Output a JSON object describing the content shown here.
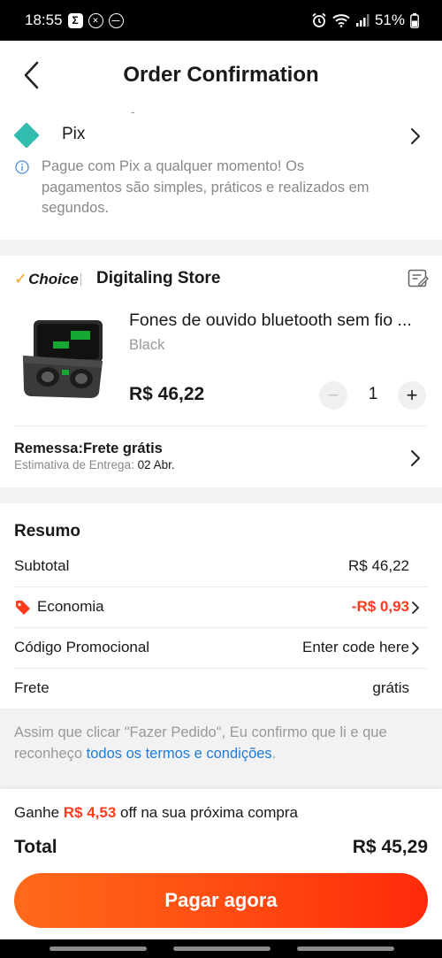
{
  "status_bar": {
    "time": "18:55",
    "battery": "51%",
    "icons": [
      "sigma-icon",
      "x-circle-icon",
      "minus-circle-icon",
      "alarm-icon",
      "wifi-icon",
      "signal-icon",
      "battery-icon"
    ]
  },
  "header": {
    "title": "Order Confirmation",
    "back_icon": "chevron-left-icon"
  },
  "payment": {
    "dash": "-",
    "method": "Pix",
    "note": "Pague com Pix a qualquer momento! Os pagamentos são simples, práticos e realizados em segundos.",
    "icon": "pix-icon"
  },
  "store": {
    "badge": "Choice",
    "name": "Digitaling Store",
    "note_icon": "edit-note-icon"
  },
  "product": {
    "title": "Fones de ouvido bluetooth sem fio ...",
    "variant": "Black",
    "price": "R$ 46,22",
    "quantity": "1",
    "minus": "−",
    "plus": "+"
  },
  "shipping": {
    "title": "Remessa:Frete grátis",
    "estimate_label": "Estimativa de Entrega:",
    "estimate_date": "02 Abr."
  },
  "summary": {
    "title": "Resumo",
    "subtotal_label": "Subtotal",
    "subtotal_value": "R$ 46,22",
    "savings_label": "Economia",
    "savings_value": "-R$ 0,93",
    "promo_label": "Código Promocional",
    "promo_value": "Enter code here",
    "shipping_label": "Frete",
    "shipping_value": "grátis"
  },
  "terms": {
    "text": "Assim que clicar \"Fazer Pedido\", Eu confirmo que li e que reconheço ",
    "link": "todos os termos e condições",
    "end": "."
  },
  "footer": {
    "earn_prefix": "Ganhe ",
    "earn_amount": "R$ 4,53",
    "earn_suffix": " off na sua próxima compra",
    "total_label": "Total",
    "total_value": "R$ 45,29",
    "pay_button": "Pagar agora"
  },
  "colors": {
    "accent": "#ff4a12",
    "red_text": "#ff3b1f",
    "link": "#1f7bd9",
    "pix": "#32bcad"
  }
}
